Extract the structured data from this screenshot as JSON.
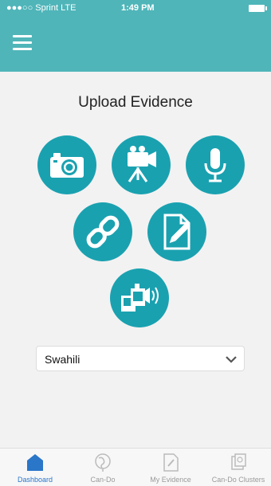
{
  "status_bar": {
    "carrier": "●●●○○ Sprint  LTE",
    "time": "1:49 PM"
  },
  "page": {
    "title": "Upload Evidence"
  },
  "upload_options": [
    {
      "icon": "camera-icon"
    },
    {
      "icon": "video-camera-icon"
    },
    {
      "icon": "microphone-icon"
    },
    {
      "icon": "link-icon"
    },
    {
      "icon": "document-edit-icon"
    },
    {
      "icon": "media-audio-icon"
    }
  ],
  "language_select": {
    "selected": "Swahili"
  },
  "tabbar": {
    "tabs": [
      {
        "label": "Dashboard",
        "icon": "home-icon",
        "active": true
      },
      {
        "label": "Can-Do",
        "icon": "globe-icon",
        "active": false
      },
      {
        "label": "My Evidence",
        "icon": "evidence-icon",
        "active": false
      },
      {
        "label": "Can-Do Clusters",
        "icon": "clusters-icon",
        "active": false
      }
    ]
  },
  "colors": {
    "header": "#4fb5b9",
    "circle": "#1aa1b0",
    "active_tab": "#2a76c9"
  }
}
